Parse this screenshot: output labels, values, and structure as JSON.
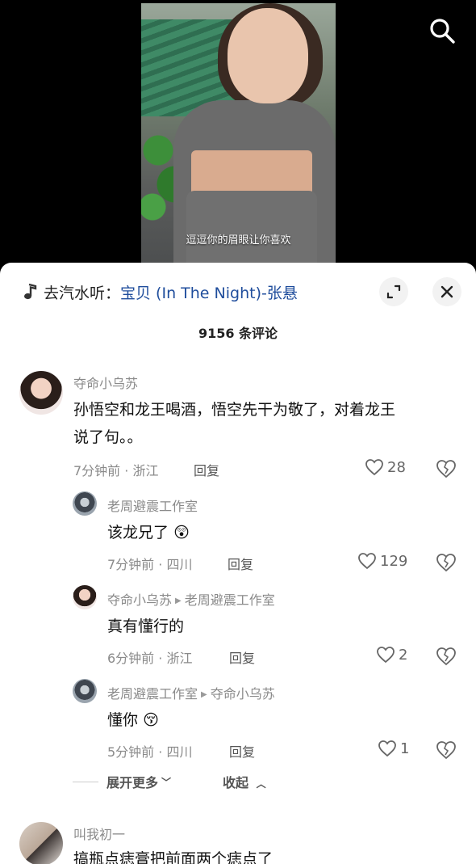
{
  "video": {
    "subtitle": "逗逗你的眉眼让你喜欢",
    "search_icon": "search-icon"
  },
  "sheet": {
    "music_prefix": "去汽水听：",
    "music_song": "宝贝 (In The Night)-张悬",
    "comment_count": "9156 条评论"
  },
  "comments": [
    {
      "user": "夺命小乌苏",
      "text_line1": "孙悟空和龙王喝酒，悟空先干为敬了，对着龙王",
      "text_line2": "说了句。。",
      "meta": "7分钟前 · 浙江",
      "reply": "回复",
      "likes": "28"
    }
  ],
  "replies": [
    {
      "user": "老周避震工作室",
      "target": "",
      "text": "该龙兄了",
      "meta": "7分钟前 · 四川",
      "reply": "回复",
      "likes": "129"
    },
    {
      "user": "夺命小乌苏",
      "target": "老周避震工作室",
      "text": "真有懂行的",
      "meta": "6分钟前 · 浙江",
      "reply": "回复",
      "likes": "2"
    },
    {
      "user": "老周避震工作室",
      "target": "夺命小乌苏",
      "text": "懂你",
      "meta": "5分钟前 · 四川",
      "reply": "回复",
      "likes": "1"
    }
  ],
  "thread_controls": {
    "expand": "展开更多",
    "collapse": "收起"
  },
  "next_comment": {
    "user": "叫我初一",
    "text": "搞瓶点痣膏把前面两个痣点了"
  }
}
